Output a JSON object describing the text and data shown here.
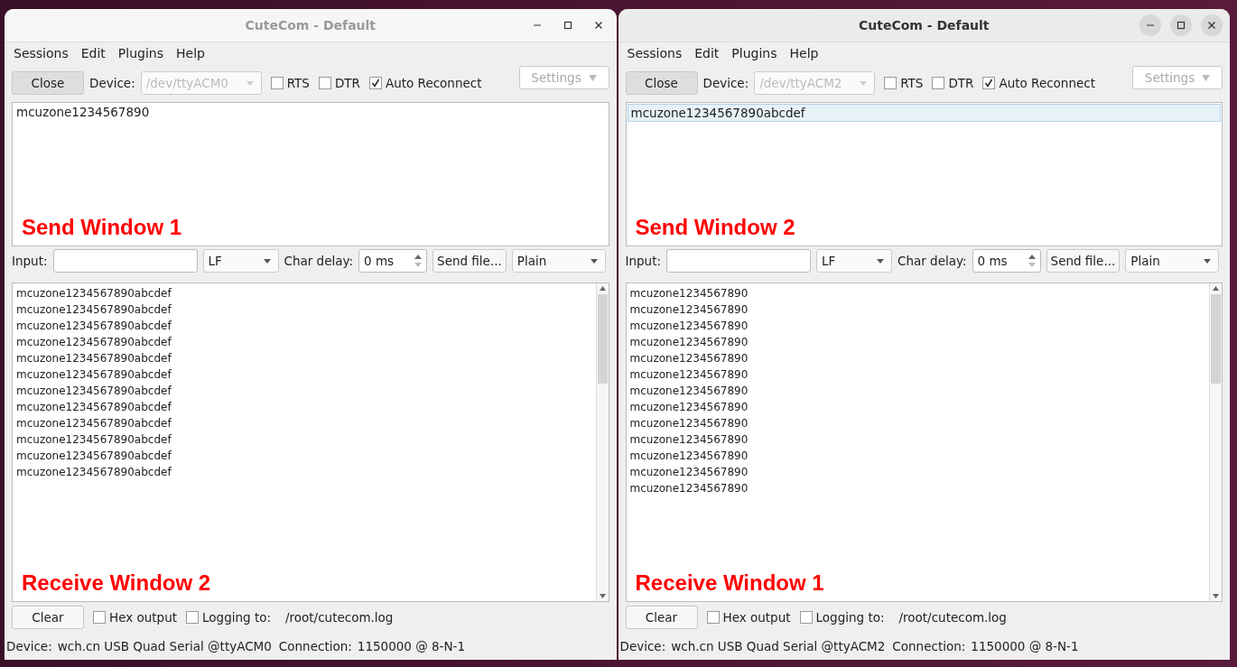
{
  "windows": [
    {
      "title": "CuteCom - Default",
      "focused": false,
      "menu": [
        "Sessions",
        "Edit",
        "Plugins",
        "Help"
      ],
      "toolbar": {
        "close_button": "Close",
        "device_label": "Device:",
        "device": "/dev/ttyACM0",
        "checkboxes": [
          {
            "label": "RTS",
            "checked": false
          },
          {
            "label": "DTR",
            "checked": false
          },
          {
            "label": "Auto Reconnect",
            "checked": true
          }
        ],
        "settings_button": "Settings"
      },
      "send_history": [
        {
          "text": "mcuzone1234567890",
          "selected": false
        }
      ],
      "send_annotation": "Send Window 1",
      "input_row": {
        "label": "Input:",
        "line_ending": "LF",
        "char_delay_label": "Char delay:",
        "char_delay": "0 ms",
        "send_file_button": "Send file...",
        "format": "Plain"
      },
      "receive_lines": [
        "mcuzone1234567890abcdef",
        "mcuzone1234567890abcdef",
        "mcuzone1234567890abcdef",
        "mcuzone1234567890abcdef",
        "mcuzone1234567890abcdef",
        "mcuzone1234567890abcdef",
        "mcuzone1234567890abcdef",
        "mcuzone1234567890abcdef",
        "mcuzone1234567890abcdef",
        "mcuzone1234567890abcdef",
        "mcuzone1234567890abcdef",
        "mcuzone1234567890abcdef"
      ],
      "receive_annotation": "Receive Window 2",
      "bottom": {
        "clear_button": "Clear",
        "checkboxes": [
          {
            "label": "Hex output",
            "checked": false
          },
          {
            "label": "Logging to:",
            "checked": false
          }
        ],
        "log_path": "/root/cutecom.log"
      },
      "status_bar": {
        "device_label": "Device:",
        "device": "wch.cn USB Quad Serial @ttyACM0",
        "connection_label": "Connection:",
        "connection": "1150000 @ 8-N-1"
      }
    },
    {
      "title": "CuteCom - Default",
      "focused": true,
      "menu": [
        "Sessions",
        "Edit",
        "Plugins",
        "Help"
      ],
      "toolbar": {
        "close_button": "Close",
        "device_label": "Device:",
        "device": "/dev/ttyACM2",
        "checkboxes": [
          {
            "label": "RTS",
            "checked": false
          },
          {
            "label": "DTR",
            "checked": false
          },
          {
            "label": "Auto Reconnect",
            "checked": true
          }
        ],
        "settings_button": "Settings"
      },
      "send_history": [
        {
          "text": "mcuzone1234567890abcdef",
          "selected": true
        }
      ],
      "send_annotation": "Send Window 2",
      "input_row": {
        "label": "Input:",
        "line_ending": "LF",
        "char_delay_label": "Char delay:",
        "char_delay": "0 ms",
        "send_file_button": "Send file...",
        "format": "Plain"
      },
      "receive_lines": [
        "mcuzone1234567890",
        "mcuzone1234567890",
        "mcuzone1234567890",
        "mcuzone1234567890",
        "mcuzone1234567890",
        "mcuzone1234567890",
        "mcuzone1234567890",
        "mcuzone1234567890",
        "mcuzone1234567890",
        "mcuzone1234567890",
        "mcuzone1234567890",
        "mcuzone1234567890",
        "mcuzone1234567890"
      ],
      "receive_annotation": "Receive Window 1",
      "bottom": {
        "clear_button": "Clear",
        "checkboxes": [
          {
            "label": "Hex output",
            "checked": false
          },
          {
            "label": "Logging to:",
            "checked": false
          }
        ],
        "log_path": "/root/cutecom.log"
      },
      "status_bar": {
        "device_label": "Device:",
        "device": "wch.cn USB Quad Serial @ttyACM2",
        "connection_label": "Connection:",
        "connection": "1150000 @ 8-N-1"
      }
    }
  ]
}
